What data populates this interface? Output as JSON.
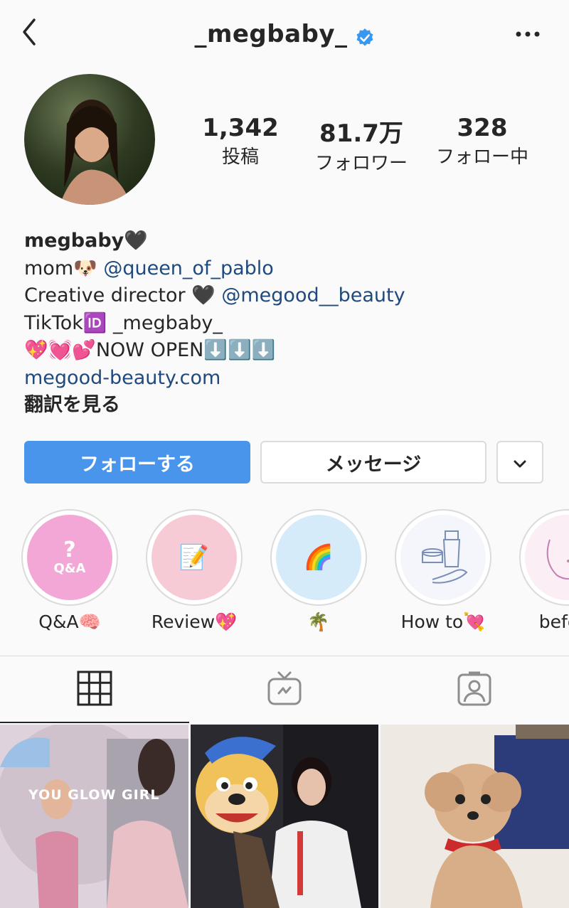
{
  "header": {
    "username": "_megbaby_"
  },
  "stats": [
    {
      "value": "1,342",
      "label": "投稿"
    },
    {
      "value": "81.7万",
      "label": "フォロワー"
    },
    {
      "value": "328",
      "label": "フォロー中"
    }
  ],
  "bio": {
    "name": "megbaby🖤",
    "line1_text": "mom🐶 ",
    "line1_mention": "@queen_of_pablo",
    "line2_text": "Creative director 🖤 ",
    "line2_mention": "@megood__beauty",
    "line3": "TikTok🆔 _megbaby_",
    "line4": "💖💓💕NOW OPEN⬇️⬇️⬇️",
    "website": "megood-beauty.com",
    "translate": "翻訳を見る"
  },
  "actions": {
    "follow_label": "フォローする",
    "message_label": "メッセージ"
  },
  "highlights": [
    {
      "label": "Q&A🧠",
      "cover_text": "Q&A",
      "cover_icon": "question-mark"
    },
    {
      "label": "Review💖",
      "cover_text": "📝"
    },
    {
      "label": "🌴",
      "cover_text": "🌈"
    },
    {
      "label": "How to💘",
      "cover_icon": "skincare-products-icon"
    },
    {
      "label": "before"
    }
  ],
  "post_overlay_text": "YOU GLOW GIRL",
  "colors": {
    "follow_button": "#4a95ec",
    "link": "#20497d",
    "verified": "#3897f0"
  }
}
